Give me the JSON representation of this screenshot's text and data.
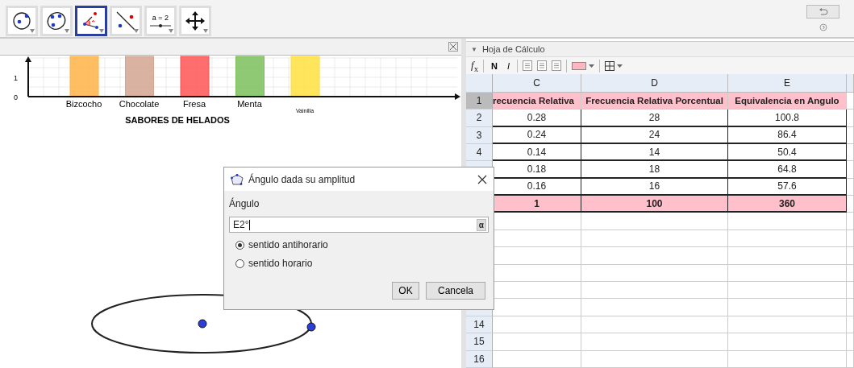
{
  "toolbar": {
    "tools": [
      {
        "kind": "circle-point",
        "selected": false
      },
      {
        "kind": "conic",
        "selected": false
      },
      {
        "kind": "angle",
        "selected": true
      },
      {
        "kind": "line-point",
        "selected": false
      },
      {
        "kind": "slider",
        "label": "a = 2",
        "selected": false
      },
      {
        "kind": "move",
        "selected": false
      }
    ]
  },
  "graphics": {
    "bar_chart": {
      "title": "SABORES DE HELADOS",
      "yticks": [
        "1",
        "0"
      ],
      "bars": [
        {
          "label": "Bizcocho",
          "color": "#ffb347"
        },
        {
          "label": "Chocolate",
          "color": "#d4a590"
        },
        {
          "label": "Fresa",
          "color": "#ff5555"
        },
        {
          "label": "Menta",
          "color": "#7cbf5a"
        },
        {
          "label": "Vainilla",
          "color": "#ffe040",
          "small": true
        }
      ]
    }
  },
  "spreadsheet": {
    "collapse": "▼",
    "title": "Hoja de Cálculo",
    "toolbar": {
      "formula": "*f*$_{x}$",
      "bold": "N",
      "italic": "I"
    },
    "columns": [
      "C",
      "D",
      "E"
    ],
    "rows": [
      {
        "number": "1",
        "kind": "header",
        "cells": [
          "recuencia Relativa",
          "Frecuencia Relativa Porcentual",
          "Equivalencia en Angulo"
        ]
      },
      {
        "number": "2",
        "kind": "data",
        "cells": [
          "0.28",
          "28",
          "100.8"
        ]
      },
      {
        "number": "3",
        "kind": "data",
        "cells": [
          "0.24",
          "24",
          "86.4"
        ]
      },
      {
        "number": "4",
        "kind": "data",
        "cells": [
          "0.14",
          "14",
          "50.4"
        ]
      },
      {
        "kind": "data",
        "cells": [
          "0.18",
          "18",
          "64.8"
        ]
      },
      {
        "kind": "data",
        "cells": [
          "0.16",
          "16",
          "57.6"
        ]
      },
      {
        "kind": "total",
        "cells": [
          "1",
          "100",
          "360"
        ]
      },
      {
        "kind": "empty"
      },
      {
        "kind": "empty"
      },
      {
        "kind": "empty"
      },
      {
        "kind": "empty"
      },
      {
        "kind": "empty"
      },
      {
        "kind": "empty"
      },
      {
        "number": "14",
        "kind": "empty"
      },
      {
        "number": "15",
        "kind": "empty"
      },
      {
        "number": "16",
        "kind": "empty"
      }
    ]
  },
  "dialog": {
    "title": "Ángulo dada su amplitud",
    "field_label": "Ángulo",
    "value": "E2°",
    "symbol": "α",
    "options": [
      {
        "label": "sentido antihorario",
        "selected": true
      },
      {
        "label": "sentido horario",
        "selected": false
      }
    ],
    "buttons": [
      "OK",
      "Cancela"
    ]
  }
}
